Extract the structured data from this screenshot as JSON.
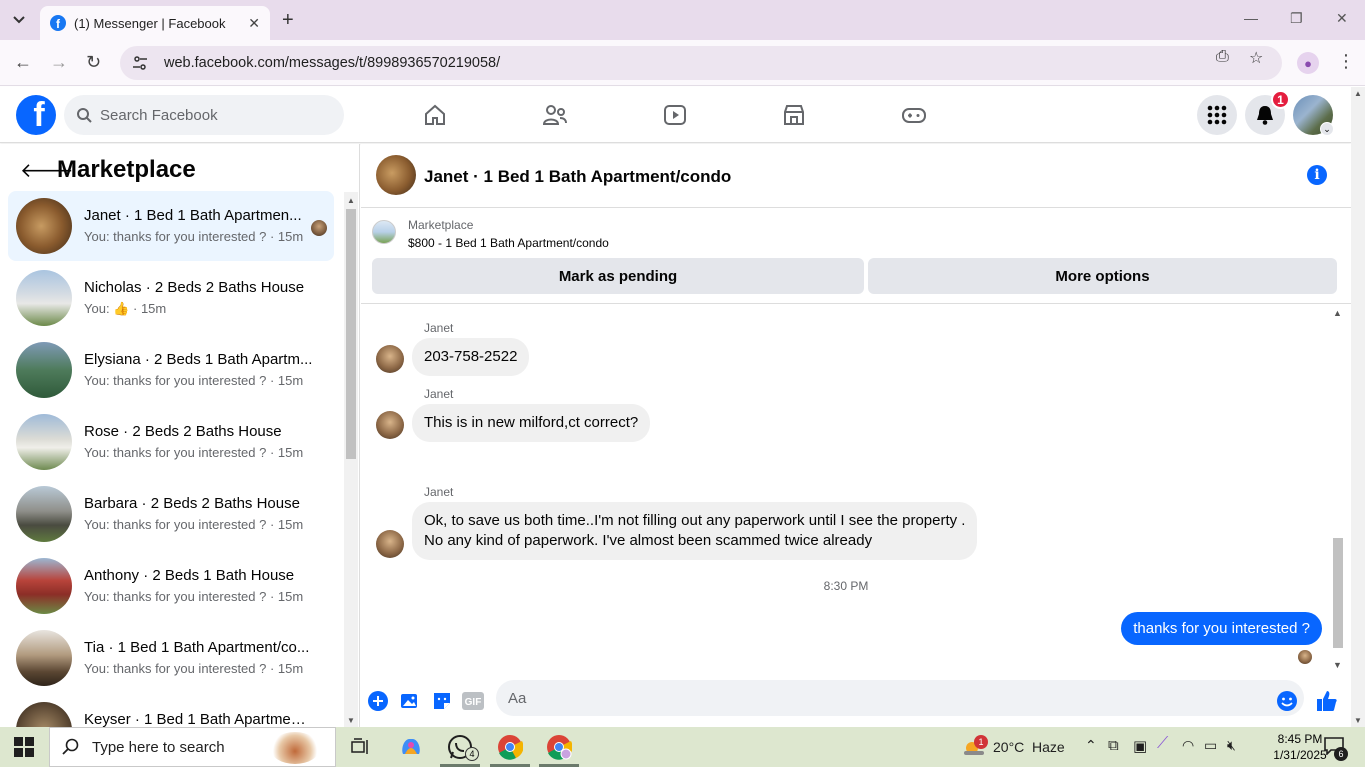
{
  "browser": {
    "tab_title": "(1) Messenger | Facebook",
    "url": "web.facebook.com/messages/t/8998936570219058/"
  },
  "fb": {
    "search_placeholder": "Search Facebook",
    "notification_count": "1"
  },
  "sidebar": {
    "title": "Marketplace",
    "conversations": [
      {
        "name": "Janet · 1 Bed 1 Bath Apartmen...",
        "preview": "You: thanks for you interested ? · 15m",
        "active": true
      },
      {
        "name": "Nicholas · 2 Beds 2 Baths House",
        "preview_prefix": "You:",
        "preview_suffix": "· 15m",
        "preview_icon": "thumbs-up-icon"
      },
      {
        "name": "Elysiana · 2 Beds 1 Bath Apartm...",
        "preview": "You: thanks for you interested ? · 15m"
      },
      {
        "name": "Rose · 2 Beds 2 Baths House",
        "preview": "You: thanks for you interested ? · 15m"
      },
      {
        "name": "Barbara · 2 Beds 2 Baths House",
        "preview": "You: thanks for you interested ? · 15m"
      },
      {
        "name": "Anthony · 2 Beds 1 Bath House",
        "preview": "You: thanks for you interested ? · 15m"
      },
      {
        "name": "Tia · 1 Bed 1 Bath Apartment/co...",
        "preview": "You: thanks for you interested ? · 15m"
      },
      {
        "name": "Keyser · 1 Bed 1 Bath Apartment...",
        "preview": ""
      }
    ]
  },
  "chat": {
    "title": "Janet · 1 Bed 1 Bath Apartment/condo",
    "listing_category": "Marketplace",
    "listing_name": "$800 - 1 Bed 1 Bath Apartment/condo",
    "mark_pending_label": "Mark as pending",
    "more_options_label": "More options",
    "messages": [
      {
        "sender": "Janet",
        "text": "203-758-2522"
      },
      {
        "sender": "Janet",
        "text": "This is in new milford,ct correct?"
      },
      {
        "sender": "Janet",
        "text_line1": "Ok, to save us both time..I'm not filling out any paperwork until I see the property .",
        "text_line2": "No any kind of paperwork.  I've almost been scammed twice already"
      }
    ],
    "timestamp": "8:30 PM",
    "my_message": "thanks for you interested ?",
    "composer_placeholder": "Aa"
  },
  "taskbar": {
    "search_placeholder": "Type here to search",
    "whatsapp_badge": "4",
    "weather_badge": "1",
    "temperature": "20°C",
    "weather": "Haze",
    "time": "8:45 PM",
    "date": "1/31/2025",
    "notification_count": "6"
  },
  "colors": {
    "fb_blue": "#0866ff",
    "active_convo": "#ebf5ff",
    "taskbar": "#dde7cf",
    "tabbar": "#e8dcec"
  }
}
